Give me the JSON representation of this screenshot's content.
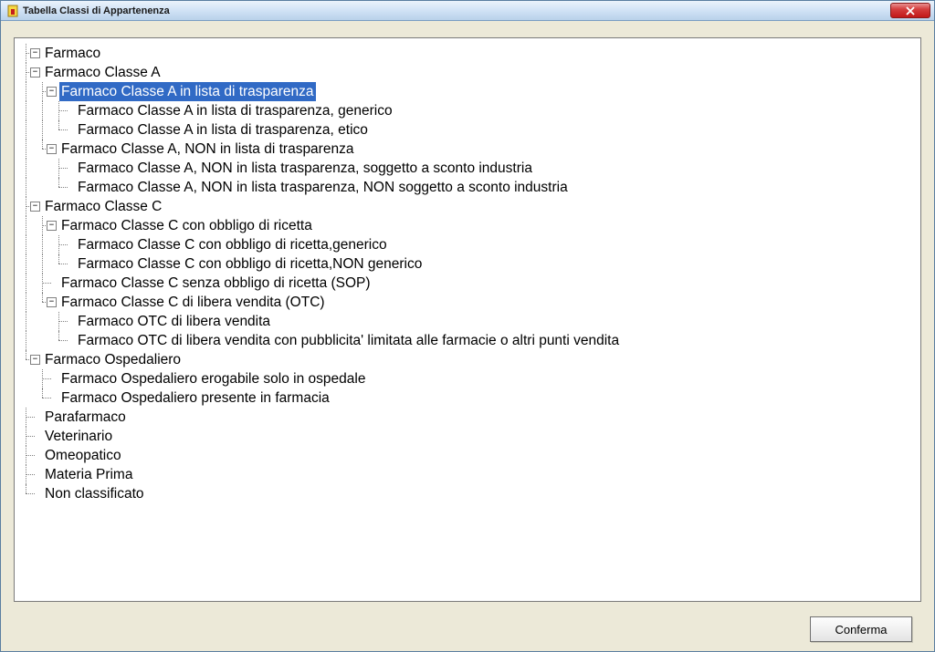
{
  "window": {
    "title": "Tabella Classi di Appartenenza"
  },
  "tree": {
    "nodes": [
      {
        "depth": 0,
        "guides": "",
        "toggle": "minus",
        "label": "Farmaco",
        "selected": false
      },
      {
        "depth": 1,
        "guides": "v",
        "toggle": "minus",
        "label": "Farmaco Classe A",
        "selected": false
      },
      {
        "depth": 2,
        "guides": "vv",
        "toggle": "minus",
        "label": "Farmaco Classe A in lista di trasparenza",
        "selected": true
      },
      {
        "depth": 3,
        "guides": "vvv",
        "toggle": "",
        "label": "Farmaco Classe A in lista di trasparenza, generico",
        "selected": false
      },
      {
        "depth": 3,
        "guides": "vvl",
        "toggle": "",
        "label": "Farmaco Classe A in lista di trasparenza, etico",
        "selected": false
      },
      {
        "depth": 2,
        "guides": "vl",
        "toggle": "minus",
        "label": "Farmaco Classe A, NON in lista di trasparenza",
        "selected": false
      },
      {
        "depth": 3,
        "guides": "v.v",
        "toggle": "",
        "label": "Farmaco Classe A, NON in lista trasparenza, soggetto a sconto industria",
        "selected": false
      },
      {
        "depth": 3,
        "guides": "v.l",
        "toggle": "",
        "label": "Farmaco Classe A, NON in lista trasparenza, NON soggetto a sconto industria",
        "selected": false
      },
      {
        "depth": 1,
        "guides": "v",
        "toggle": "minus",
        "label": "Farmaco Classe C",
        "selected": false
      },
      {
        "depth": 2,
        "guides": "vv",
        "toggle": "minus",
        "label": "Farmaco Classe C con obbligo di ricetta",
        "selected": false
      },
      {
        "depth": 3,
        "guides": "vvv",
        "toggle": "",
        "label": "Farmaco Classe C con obbligo di ricetta,generico",
        "selected": false
      },
      {
        "depth": 3,
        "guides": "vvl",
        "toggle": "",
        "label": "Farmaco Classe C con obbligo di ricetta,NON generico",
        "selected": false
      },
      {
        "depth": 2,
        "guides": "vv",
        "toggle": "",
        "label": "Farmaco Classe C senza obbligo di ricetta (SOP)",
        "selected": false
      },
      {
        "depth": 2,
        "guides": "vl",
        "toggle": "minus",
        "label": "Farmaco Classe C di libera vendita (OTC)",
        "selected": false
      },
      {
        "depth": 3,
        "guides": "v.v",
        "toggle": "",
        "label": "Farmaco OTC di libera vendita",
        "selected": false
      },
      {
        "depth": 3,
        "guides": "v.l",
        "toggle": "",
        "label": "Farmaco OTC di libera vendita con pubblicita' limitata alle farmacie o altri punti vendita",
        "selected": false
      },
      {
        "depth": 1,
        "guides": "l",
        "toggle": "minus",
        "label": "Farmaco Ospedaliero",
        "selected": false
      },
      {
        "depth": 2,
        "guides": ".v",
        "toggle": "",
        "label": "Farmaco Ospedaliero erogabile solo in ospedale",
        "selected": false
      },
      {
        "depth": 2,
        "guides": ".l",
        "toggle": "",
        "label": "Farmaco Ospedaliero presente in farmacia",
        "selected": false
      },
      {
        "depth": 0,
        "guides": "b",
        "toggle": "",
        "label": "Parafarmaco",
        "selected": false,
        "root": true
      },
      {
        "depth": 0,
        "guides": "b",
        "toggle": "",
        "label": "Veterinario",
        "selected": false,
        "root": true
      },
      {
        "depth": 0,
        "guides": "b",
        "toggle": "",
        "label": "Omeopatico",
        "selected": false,
        "root": true
      },
      {
        "depth": 0,
        "guides": "b",
        "toggle": "",
        "label": "Materia Prima",
        "selected": false,
        "root": true
      },
      {
        "depth": 0,
        "guides": "l0",
        "toggle": "",
        "label": "Non classificato",
        "selected": false,
        "root": true
      }
    ]
  },
  "buttons": {
    "confirm": "Conferma"
  }
}
